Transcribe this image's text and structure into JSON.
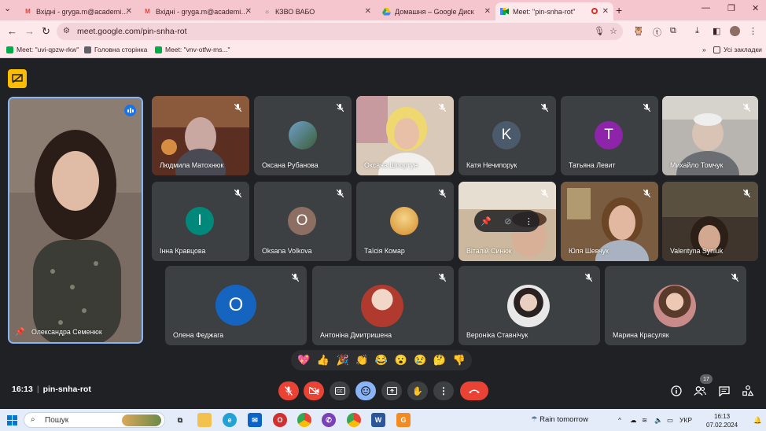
{
  "browser": {
    "tabs": [
      {
        "title": "Вхідні - gryga.m@academia.vn",
        "icon": "gmail-icon"
      },
      {
        "title": "Вхідні - gryga.m@academia.vn",
        "icon": "gmail-icon"
      },
      {
        "title": "КЗВО ВАБО",
        "icon": "site-icon"
      },
      {
        "title": "Домашня – Google Диск",
        "icon": "drive-icon"
      },
      {
        "title": "Meet: \"pin-snha-rot\"",
        "icon": "meet-icon",
        "active": true
      }
    ],
    "url": "meet.google.com/pin-snha-rot",
    "bookmarks": [
      {
        "label": "Meet: \"uvi-qpzw-rkw\"",
        "icon": "meet-icon"
      },
      {
        "label": "Головна сторінка",
        "icon": "site-icon"
      },
      {
        "label": "Meet: \"vnv-otfw-ms...\"",
        "icon": "meet-icon"
      }
    ],
    "all_bookmarks": "Усі закладки"
  },
  "meet": {
    "presenter": {
      "name": "Олександра Семенюк"
    },
    "participants": [
      {
        "name": "Людмила Матохнюк",
        "kind": "video",
        "bg": "#6b3a2a"
      },
      {
        "name": "Оксана Рубанова",
        "kind": "photo",
        "bg": "#7a8ea0"
      },
      {
        "name": "Оксана Шпортун",
        "kind": "video",
        "bg": "#c7b7a8"
      },
      {
        "name": "Катя Нечипорук",
        "kind": "letter",
        "letter": "K",
        "color": "#4b5b6b"
      },
      {
        "name": "Татьяна Левит",
        "kind": "letter",
        "letter": "T",
        "color": "#8e24aa"
      },
      {
        "name": "Михайло Томчук",
        "kind": "video",
        "bg": "#9c9a98"
      },
      {
        "name": "Інна Кравцова",
        "kind": "letter",
        "letter": "I",
        "color": "#00897b"
      },
      {
        "name": "Oksana Volkova",
        "kind": "letter",
        "letter": "O",
        "color": "#8d6e63"
      },
      {
        "name": "Таїсія Комар",
        "kind": "photo",
        "bg": "#e8b04a"
      },
      {
        "name": "Віталій Синюк",
        "kind": "video",
        "bg": "#b9a48a"
      },
      {
        "name": "Юля Шевчук",
        "kind": "video",
        "bg": "#8a6b4c"
      },
      {
        "name": "Valentyna Syniuk",
        "kind": "video",
        "bg": "#4a3b2c"
      },
      {
        "name": "Олена Феджага",
        "kind": "letter",
        "letter": "O",
        "color": "#1565c0"
      },
      {
        "name": "Антоніна Дмитришена",
        "kind": "photo",
        "bg": "#b84a3a"
      },
      {
        "name": "Вероніка Ставнічук",
        "kind": "photo",
        "bg": "#cfcfcf"
      },
      {
        "name": "Марина Красуляк",
        "kind": "photo",
        "bg": "#c49a8a"
      }
    ],
    "reactions": [
      "💖",
      "👍",
      "🎉",
      "👏",
      "😂",
      "😮",
      "😢",
      "🤔",
      "👎"
    ],
    "time": "16:13",
    "meeting_code": "pin-snha-rot",
    "participant_count": "17"
  },
  "taskbar": {
    "search_placeholder": "Пошук",
    "weather": "Rain tomorrow",
    "language": "УКР",
    "time": "16:13",
    "date": "07.02.2024"
  }
}
